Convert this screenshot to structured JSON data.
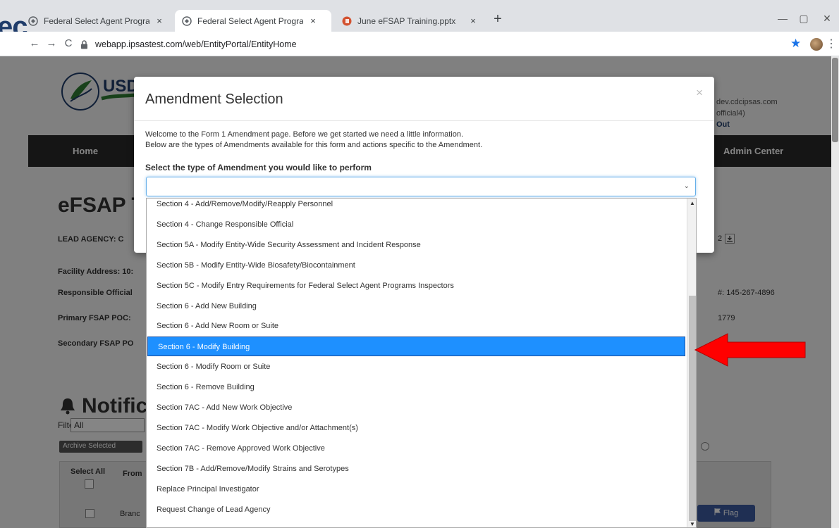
{
  "browser": {
    "tabs": [
      {
        "label": "Federal Select Agent Program Inf",
        "active": false
      },
      {
        "label": "Federal Select Agent Program Inf",
        "active": true
      },
      {
        "label": "June eFSAP Training.pptx",
        "active": false
      }
    ],
    "tab_close": "×",
    "new_tab": "+",
    "url": "webapp.ipsastest.com/web/EntityPortal/EntityHome",
    "window_controls": {
      "minimize": "—",
      "maximize": "▢",
      "close": "✕"
    },
    "nav": {
      "back": "←",
      "forward": "→",
      "reload": "C"
    },
    "star": "★",
    "menu": "⋮"
  },
  "slide_overflow": "ec",
  "page": {
    "logo_text": "USD",
    "nav": {
      "home": "Home",
      "admin_center": "Admin Center"
    },
    "user": {
      "email": "dev.cdcipsas.com",
      "role": "official4)",
      "signout": "Out"
    },
    "title": "eFSAP T",
    "lead_agency_label": "LEAD AGENCY: C",
    "lead_agency_value_right": "2",
    "facility_address_label": "Facility Address: 10:",
    "responsible_official_label": "Responsible Official",
    "responsible_official_phone": "#: 145-267-4896",
    "primary_poc_label": "Primary FSAP POC:",
    "primary_poc_value": "1779",
    "secondary_poc_label": "Secondary FSAP PO",
    "notifications_title": "Notifica",
    "filter_label": "Filter:",
    "filter_value": "All",
    "archive_button": "Archive Selected",
    "table": {
      "select_all": "Select All",
      "from": "From",
      "row_text": "Branc"
    },
    "flag_button": "Flag"
  },
  "modal": {
    "title": "Amendment Selection",
    "close": "×",
    "intro_line1": "Welcome to the Form 1 Amendment page. Before we get started we need a little information.",
    "intro_line2": "Below are the types of Amendments available for this form and actions specific to the Amendment.",
    "select_label": "Select the type of Amendment you would like to perform",
    "select_value": ""
  },
  "dropdown": {
    "options": [
      "Section 4 - Add/Remove/Modify/Reapply Personnel",
      "Section 4 - Change Responsible Official",
      "Section 5A - Modify Entity-Wide Security Assessment and Incident Response",
      "Section 5B - Modify Entity-Wide Biosafety/Biocontainment",
      "Section 5C - Modify Entry Requirements for Federal Select Agent Programs Inspectors",
      "Section 6 - Add New Building",
      "Section 6 - Add New Room or Suite",
      "Section 6 - Modify Building",
      "Section 6 - Modify Room or Suite",
      "Section 6 - Remove Building",
      "Section 7AC - Add New Work Objective",
      "Section 7AC - Modify Work Objective and/or Attachment(s)",
      "Section 7AC - Remove Approved Work Objective",
      "Section 7B - Add/Remove/Modify Strains and Serotypes",
      "Replace Principal Investigator",
      "Request Change of Lead Agency"
    ],
    "selected_index": 7
  },
  "colors": {
    "accent": "#1e90ff",
    "overlay": "#000000",
    "arrow": "#ff0000",
    "nav_bar": "#2a2a2a"
  },
  "icons": {
    "tab_favicon": "globe-icon",
    "pptx_favicon": "powerpoint-icon",
    "lock": "lock-icon",
    "bell": "bell-icon",
    "flag": "flag-icon",
    "download": "download-icon",
    "annotation": "red-arrow-icon"
  }
}
